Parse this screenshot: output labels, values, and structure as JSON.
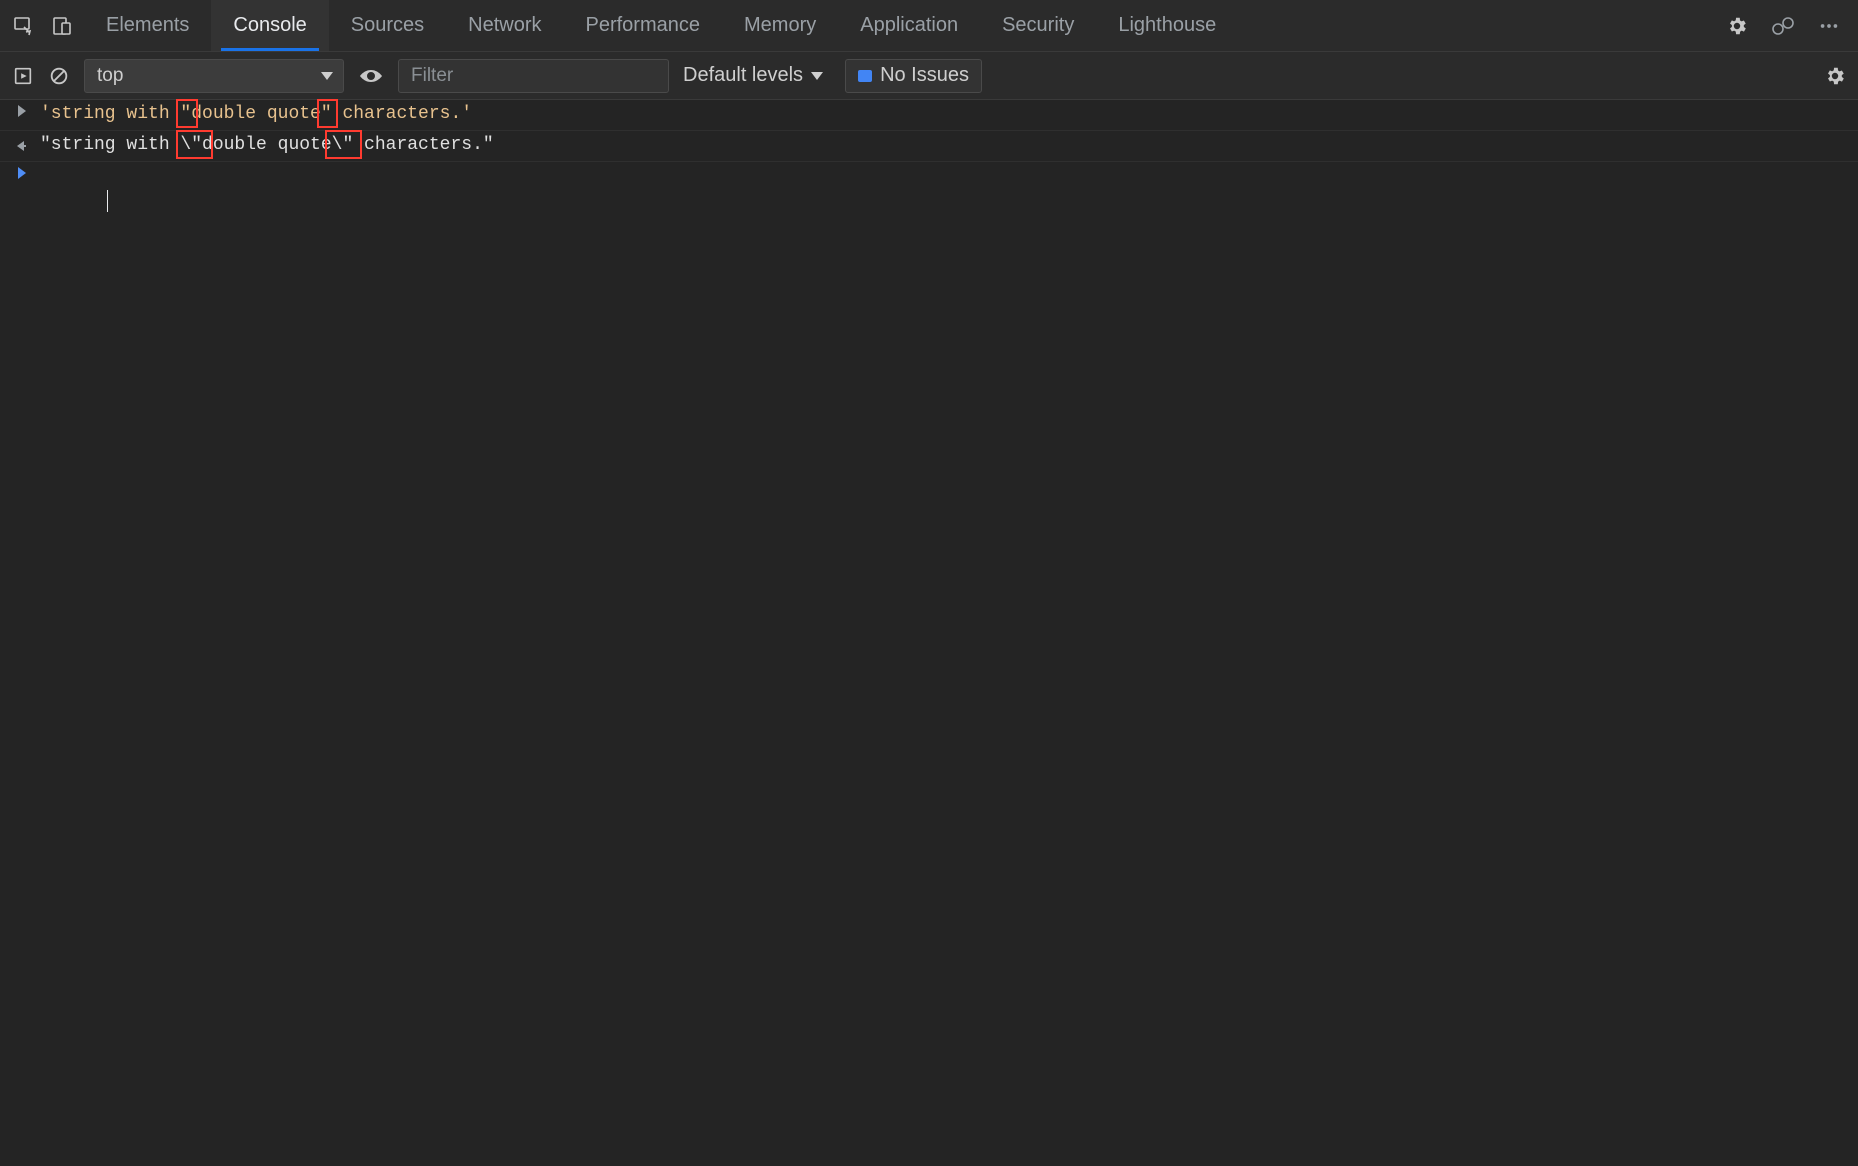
{
  "tabs": {
    "items": [
      "Elements",
      "Console",
      "Sources",
      "Network",
      "Performance",
      "Memory",
      "Application",
      "Security",
      "Lighthouse"
    ],
    "active": "Console"
  },
  "toolbar": {
    "context": "top",
    "filter_placeholder": "Filter",
    "levels_label": "Default levels",
    "issues_label": "No Issues"
  },
  "console": {
    "input_line": "'string with \"double quote\" characters.'",
    "output_line": "\"string with \\\"double quote\\\" characters.\"",
    "highlights_input": [
      {
        "left_ch": 12.6,
        "width_ch": 2.0
      },
      {
        "left_ch": 25.6,
        "width_ch": 2.0
      }
    ],
    "highlights_output": [
      {
        "left_ch": 12.6,
        "width_ch": 3.4
      },
      {
        "left_ch": 26.4,
        "width_ch": 3.4
      }
    ]
  },
  "colors": {
    "bg": "#242424",
    "panel": "#2b2b2b",
    "active_underline": "#1a73e8",
    "string": "#e8c28e",
    "highlight": "#ff3b30"
  }
}
